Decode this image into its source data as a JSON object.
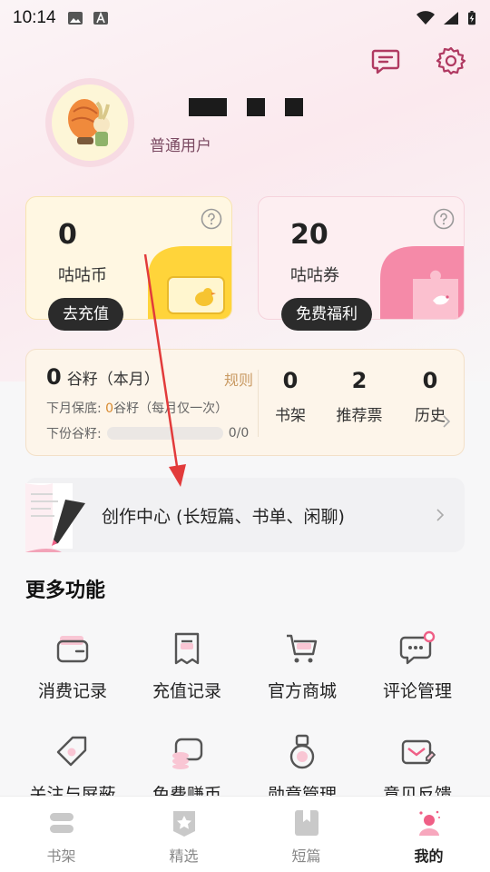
{
  "status_bar": {
    "time": "10:14"
  },
  "profile": {
    "level": "普通用户"
  },
  "wallet": {
    "coin": {
      "value": "0",
      "label": "咕咕币",
      "button": "去充值"
    },
    "ticket": {
      "value": "20",
      "label": "咕咕券",
      "button": "免费福利"
    }
  },
  "grain": {
    "amount": "0",
    "unit_label": "谷籽（本月）",
    "rule": "规则",
    "guarantee_prefix": "下月保底: ",
    "guarantee_value": "0",
    "guarantee_suffix": "谷籽（每月仅一次）",
    "next_label": "下份谷籽:",
    "progress_text": "0/0",
    "progress_fraction": 0
  },
  "stats": [
    {
      "value": "0",
      "label": "书架"
    },
    {
      "value": "2",
      "label": "推荐票"
    },
    {
      "value": "0",
      "label": "历史"
    }
  ],
  "creation": {
    "label": "创作中心 (长短篇、书单、闲聊)"
  },
  "more": {
    "title": "更多功能",
    "items": [
      {
        "label": "消费记录",
        "icon": "wallet-icon"
      },
      {
        "label": "充值记录",
        "icon": "receipt-icon"
      },
      {
        "label": "官方商城",
        "icon": "cart-icon"
      },
      {
        "label": "评论管理",
        "icon": "comment-icon"
      },
      {
        "label": "关注与屏蔽",
        "icon": "tag-icon"
      },
      {
        "label": "免费赚币",
        "icon": "coins-icon"
      },
      {
        "label": "勋章管理",
        "icon": "medal-icon"
      },
      {
        "label": "意见反馈",
        "icon": "feedback-icon"
      }
    ]
  },
  "tabs": [
    {
      "label": "书架",
      "active": false
    },
    {
      "label": "精选",
      "active": false
    },
    {
      "label": "短篇",
      "active": false
    },
    {
      "label": "我的",
      "active": true
    }
  ],
  "colors": {
    "accent_pink": "#ef5f86",
    "coin_yellow": "#ffd43a",
    "annotation_red": "#e23b3b"
  }
}
